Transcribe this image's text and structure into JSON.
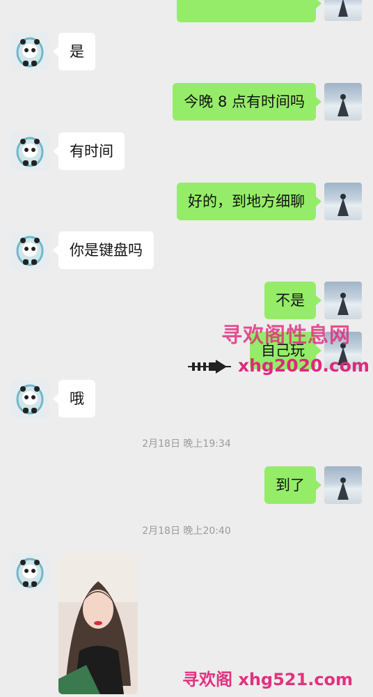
{
  "messages": [
    {
      "side": "in",
      "text": "是"
    },
    {
      "side": "out",
      "text": "今晚 8 点有时间吗"
    },
    {
      "side": "in",
      "text": "有时间"
    },
    {
      "side": "out",
      "text": "好的，到地方细聊"
    },
    {
      "side": "in",
      "text": "你是键盘吗"
    },
    {
      "side": "out",
      "text": "不是"
    },
    {
      "side": "out",
      "text": "自己玩"
    },
    {
      "side": "in",
      "text": "哦"
    },
    {
      "side": "out",
      "text": "到了"
    }
  ],
  "timestamps": [
    "2月18日 晚上19:34",
    "2月18日 晚上20:40"
  ],
  "watermarks": {
    "top_title": "寻欢阁性息网",
    "top_url": "xhg2020.com",
    "bottom": "寻欢阁 xhg521.com"
  },
  "icons": {
    "incoming_avatar": "panda-mascot-avatar",
    "outgoing_avatar": "snow-landscape-avatar",
    "photo_message": "woman-selfie-photo",
    "arrow": "arrow-right-icon"
  },
  "colors": {
    "background": "#ededed",
    "incoming_bubble": "#ffffff",
    "outgoing_bubble": "#95ec69",
    "watermark": "#e0287a"
  }
}
